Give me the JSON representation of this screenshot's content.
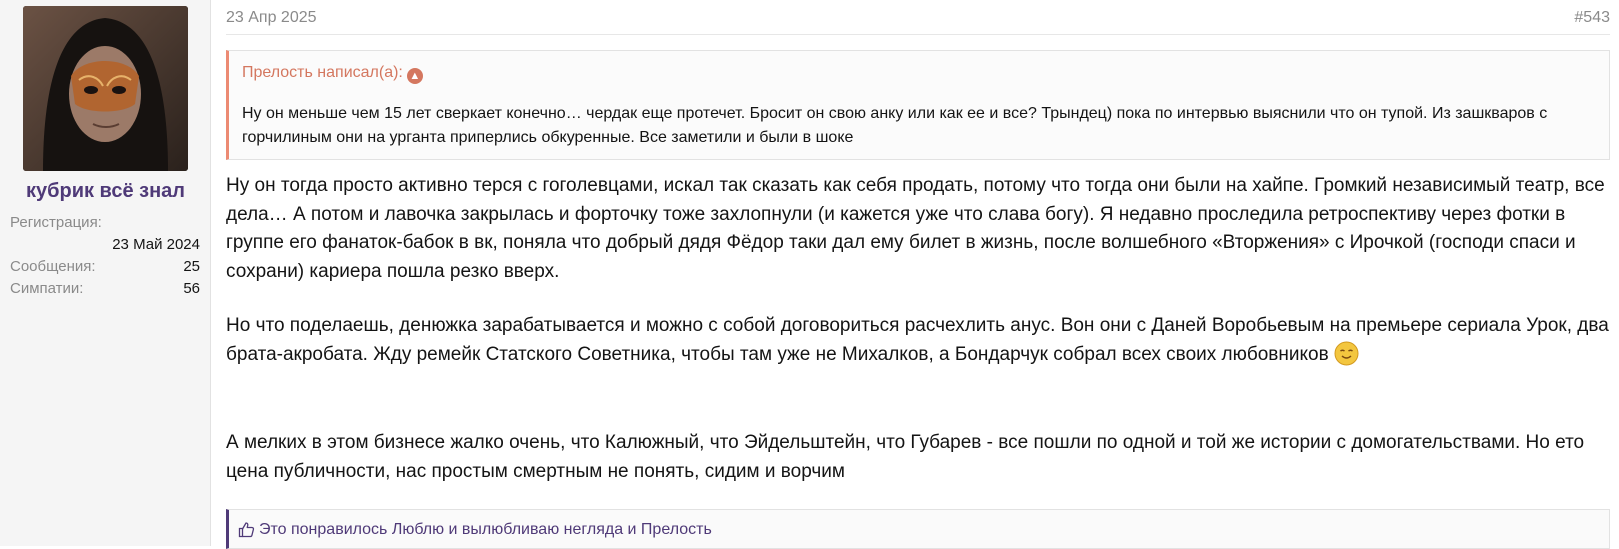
{
  "author": {
    "username": "кубрик всё знал",
    "stats": [
      {
        "label": "Регистрация:",
        "value": "23 Май 2024"
      },
      {
        "label": "Сообщения:",
        "value": "25"
      },
      {
        "label": "Симпатии:",
        "value": "56"
      }
    ]
  },
  "post": {
    "date": "23 Апр 2025",
    "number": "#543"
  },
  "quote": {
    "author_line": "Прелость написал(а):",
    "text": "Ну он меньше чем 15 лет сверкает конечно… чердак еще протечет. Бросит он свою анку или как ее и все? Трындец) пока по интервью выяснили что он тупой. Из зашкваров с горчилиным они на урганта приперлись обкуренные. Все заметили и были в шоке"
  },
  "body": {
    "p1": "Ну он тогда просто активно терся с гоголевцами, искал так сказать как себя продать, потому что тогда они были на хайпе. Громкий независимый театр, все дела… А потом и лавочка закрылась и форточку тоже захлопнули (и кажется уже что слава богу). Я недавно проследила ретроспективу через фотки в группе его фанаток-бабок в вк, поняла что добрый дядя Фёдор таки дал ему билет в жизнь, после волшебного «Вторжения» с Ирочкой (господи спаси и сохрани) кариера пошла резко вверх.",
    "p2": "Но что поделаешь, денюжка зарабатывается и можно с собой договориться расчехлить анус. Вон они с Даней Воробьевым на премьере сериала Урок, два брата-акробата. Жду ремейк Статского Советника, чтобы там уже не Михалков, а Бондарчук собрал всех своих любовников",
    "p3": "А мелких в этом бизнесе жалко очень, что Калюжный, что Эйдельштейн, что Губарев - все пошли по одной и той же истории с домогательствами. Но ето цена публичности, нас простым смертным не понять, сидим и ворчим"
  },
  "likes": {
    "text": "Это понравилось Люблю и вылюбливаю негляда и Прелость"
  },
  "colors": {
    "accent": "#4f3a78",
    "quote_accent": "#ec8a73",
    "muted": "#8a8a8a"
  },
  "icons": [
    "avatar-image",
    "quote-arrow-up-icon",
    "smiley-icon",
    "thumbs-up-icon"
  ]
}
